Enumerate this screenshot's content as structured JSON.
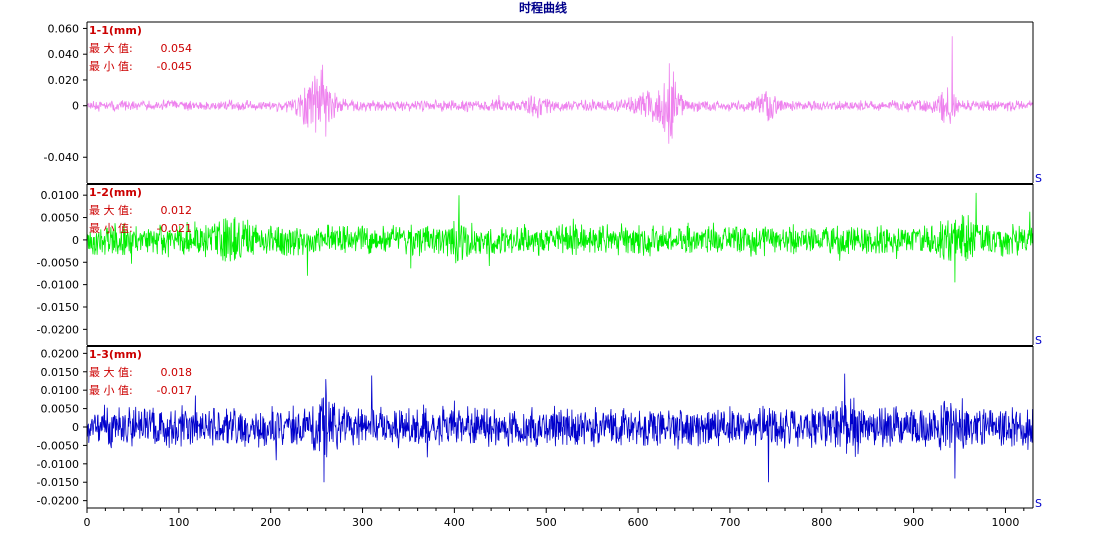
{
  "chart_data": {
    "type": "line",
    "title": "时程曲线",
    "x_unit": "S",
    "xlim": [
      0,
      1030
    ],
    "x_ticks": [
      0,
      100,
      200,
      300,
      400,
      500,
      600,
      700,
      800,
      900,
      1000
    ],
    "panels": [
      {
        "name": "1-1(mm)",
        "color": "#ee82ee",
        "max_label": "最 大 值:",
        "max_value": "0.054",
        "min_label": "最 小 值:",
        "min_value": "-0.045",
        "ylim": [
          -0.06,
          0.065
        ],
        "y_ticks": [
          0.06,
          0.04,
          0.02,
          0,
          -0.04
        ],
        "y_tick_labels": [
          "0.060",
          "0.040",
          "0.020",
          "0",
          "-0.040"
        ],
        "base_amplitude": 0.0035,
        "noise_seed": 11,
        "bursts": [
          {
            "x": 250,
            "width": 18,
            "amplitude": 0.019
          },
          {
            "x": 490,
            "width": 12,
            "amplitude": 0.006
          },
          {
            "x": 620,
            "width": 25,
            "amplitude": 0.009
          },
          {
            "x": 635,
            "width": 8,
            "amplitude": 0.02
          },
          {
            "x": 740,
            "width": 10,
            "amplitude": 0.01
          },
          {
            "x": 935,
            "width": 10,
            "amplitude": 0.012
          }
        ],
        "spikes": [
          {
            "x": 255,
            "y": 0.028
          },
          {
            "x": 260,
            "y": -0.024
          },
          {
            "x": 634,
            "y": 0.033
          },
          {
            "x": 636,
            "y": -0.022
          },
          {
            "x": 942,
            "y": 0.054
          },
          {
            "x": 940,
            "y": -0.014
          }
        ]
      },
      {
        "name": "1-2(mm)",
        "color": "#00ee00",
        "max_label": "最 大 值:",
        "max_value": "0.012",
        "min_label": "最 小 值:",
        "min_value": "-0.021",
        "ylim": [
          -0.0235,
          0.0125
        ],
        "y_ticks": [
          0.01,
          0.005,
          0,
          -0.005,
          -0.01,
          -0.015,
          -0.02
        ],
        "y_tick_labels": [
          "0.0100",
          "0.0050",
          "0",
          "-0.0050",
          "-0.0100",
          "-0.0150",
          "-0.0200"
        ],
        "base_amplitude": 0.0028,
        "noise_seed": 23,
        "bursts": [
          {
            "x": 160,
            "width": 20,
            "amplitude": 0.0025
          },
          {
            "x": 400,
            "width": 15,
            "amplitude": 0.002
          },
          {
            "x": 950,
            "width": 20,
            "amplitude": 0.0025
          }
        ],
        "spikes": [
          {
            "x": 405,
            "y": 0.01
          },
          {
            "x": 968,
            "y": 0.0105
          },
          {
            "x": 945,
            "y": -0.0095
          },
          {
            "x": 240,
            "y": -0.008
          }
        ]
      },
      {
        "name": "1-3(mm)",
        "color": "#0000cc",
        "max_label": "最 大 值:",
        "max_value": "0.018",
        "min_label": "最 小 值:",
        "min_value": "-0.017",
        "ylim": [
          -0.022,
          0.022
        ],
        "y_ticks": [
          0.02,
          0.015,
          0.01,
          0.005,
          0,
          -0.005,
          -0.01,
          -0.015,
          -0.02
        ],
        "y_tick_labels": [
          "0.0200",
          "0.0150",
          "0.0100",
          "0.0050",
          "0",
          "-0.0050",
          "-0.0100",
          "-0.0150",
          "-0.0200"
        ],
        "base_amplitude": 0.0045,
        "noise_seed": 37,
        "bursts": [
          {
            "x": 255,
            "width": 15,
            "amplitude": 0.004
          },
          {
            "x": 830,
            "width": 15,
            "amplitude": 0.003
          },
          {
            "x": 945,
            "width": 15,
            "amplitude": 0.003
          }
        ],
        "spikes": [
          {
            "x": 260,
            "y": 0.013
          },
          {
            "x": 258,
            "y": -0.015
          },
          {
            "x": 310,
            "y": 0.014
          },
          {
            "x": 825,
            "y": 0.0145
          },
          {
            "x": 742,
            "y": -0.015
          },
          {
            "x": 945,
            "y": -0.014
          }
        ]
      }
    ]
  }
}
